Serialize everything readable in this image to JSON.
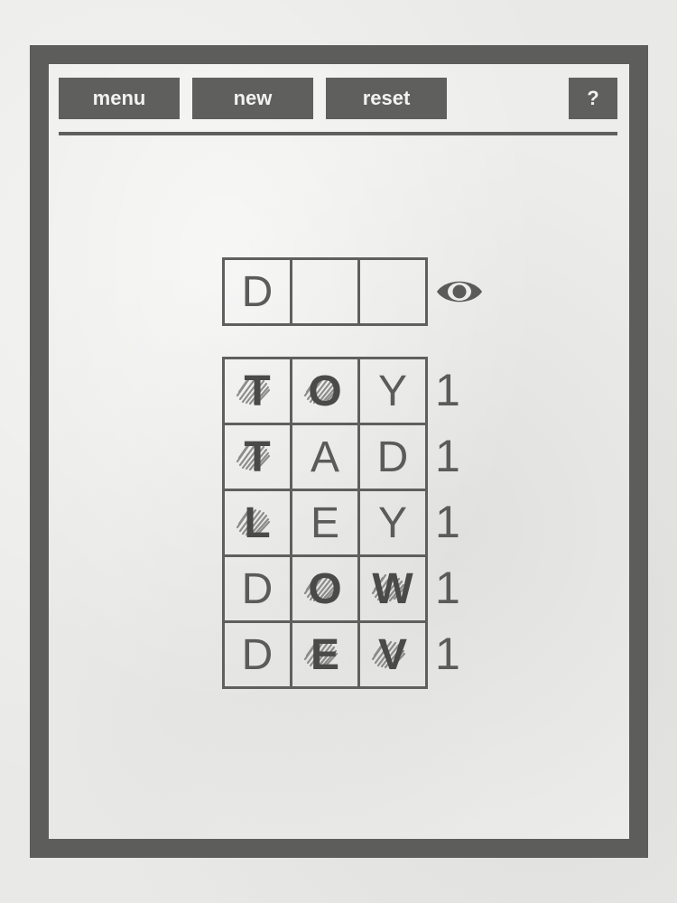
{
  "toolbar": {
    "menu_label": "menu",
    "new_label": "new",
    "reset_label": "reset",
    "help_label": "?"
  },
  "answer": {
    "cells": [
      "D",
      "",
      ""
    ],
    "reveal_icon": "eye-icon"
  },
  "guesses": [
    {
      "letters": [
        "T",
        "O",
        "Y"
      ],
      "marked": [
        true,
        true,
        false
      ],
      "score": "1"
    },
    {
      "letters": [
        "T",
        "A",
        "D"
      ],
      "marked": [
        true,
        false,
        false
      ],
      "score": "1"
    },
    {
      "letters": [
        "L",
        "E",
        "Y"
      ],
      "marked": [
        true,
        false,
        false
      ],
      "score": "1"
    },
    {
      "letters": [
        "D",
        "O",
        "W"
      ],
      "marked": [
        false,
        true,
        true
      ],
      "score": "1"
    },
    {
      "letters": [
        "D",
        "E",
        "V"
      ],
      "marked": [
        false,
        true,
        true
      ],
      "score": "1"
    }
  ],
  "colors": {
    "frame": "#5d5d5b",
    "ink": "#5b5b59",
    "panel": "#ededeb"
  }
}
